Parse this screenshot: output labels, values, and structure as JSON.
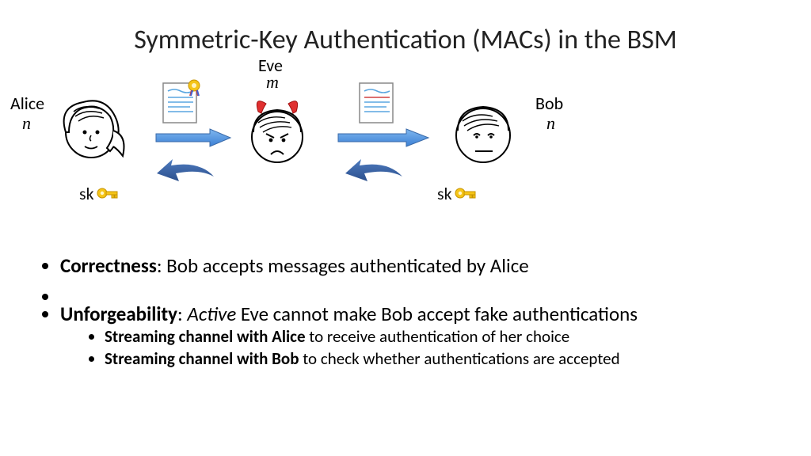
{
  "title": "Symmetric-Key Authentication (MACs) in the BSM",
  "actors": {
    "alice": {
      "name": "Alice",
      "var": "n"
    },
    "eve": {
      "name": "Eve",
      "var": "m"
    },
    "bob": {
      "name": "Bob",
      "var": "n"
    }
  },
  "sk_label": "sk",
  "bullets": {
    "correctness": {
      "term": "Correctness",
      "text": ": Bob accepts messages authenticated by Alice"
    },
    "unforgeability": {
      "term": "Unforgeability",
      "colon": ": ",
      "active": "Active",
      "rest": " Eve cannot make Bob accept fake authentications",
      "sub": [
        {
          "bold": "Streaming channel with Alice",
          "rest": " to receive authentication of her choice"
        },
        {
          "bold": "Streaming channel with Bob",
          "rest": " to check whether authentications are accepted"
        }
      ]
    }
  }
}
